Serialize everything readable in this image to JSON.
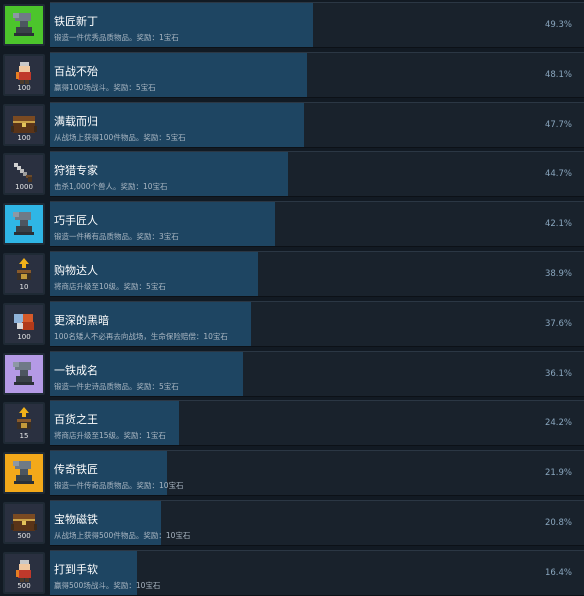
{
  "achievements": [
    {
      "title": "铁匠新丁",
      "desc": "锻造一件优秀品质物品。奖励：1宝石",
      "percent": 49.3,
      "percent_label": "49.3%",
      "icon": "anvil-icon",
      "icon_bg": "#4cc52c",
      "badge": ""
    },
    {
      "title": "百战不殆",
      "desc": "赢得100场战斗。奖励：5宝石",
      "percent": 48.1,
      "percent_label": "48.1%",
      "icon": "warrior-icon",
      "icon_bg": "#2a3040",
      "badge": "100"
    },
    {
      "title": "满载而归",
      "desc": "从战场上获得100件物品。奖励：5宝石",
      "percent": 47.7,
      "percent_label": "47.7%",
      "icon": "treasure-chest-icon",
      "icon_bg": "#2a3040",
      "badge": "100"
    },
    {
      "title": "狩猎专家",
      "desc": "击杀1,000个兽人。奖励：10宝石",
      "percent": 44.7,
      "percent_label": "44.7%",
      "icon": "sword-icon",
      "icon_bg": "#2a3040",
      "badge": "1000"
    },
    {
      "title": "巧手匠人",
      "desc": "锻造一件稀有品质物品。奖励：3宝石",
      "percent": 42.1,
      "percent_label": "42.1%",
      "icon": "anvil-icon",
      "icon_bg": "#2fb6e6",
      "badge": ""
    },
    {
      "title": "购物达人",
      "desc": "将商店升级至10级。奖励：5宝石",
      "percent": 38.9,
      "percent_label": "38.9%",
      "icon": "shop-upgrade-icon",
      "icon_bg": "#2a3040",
      "badge": "10"
    },
    {
      "title": "更深的黑暗",
      "desc": "100名矮人不必再去向战场，生命保险赔偿：10宝石",
      "percent": 37.6,
      "percent_label": "37.6%",
      "icon": "dwarf-icon",
      "icon_bg": "#2a3040",
      "badge": "100"
    },
    {
      "title": "一铁成名",
      "desc": "锻造一件史诗品质物品。奖励：5宝石",
      "percent": 36.1,
      "percent_label": "36.1%",
      "icon": "anvil-icon",
      "icon_bg": "#b49ae6",
      "badge": ""
    },
    {
      "title": "百货之王",
      "desc": "将商店升级至15级。奖励：1宝石",
      "percent": 24.2,
      "percent_label": "24.2%",
      "icon": "shop-upgrade-icon",
      "icon_bg": "#2a3040",
      "badge": "15"
    },
    {
      "title": "传奇铁匠",
      "desc": "锻造一件传奇品质物品。奖励：10宝石",
      "percent": 21.9,
      "percent_label": "21.9%",
      "icon": "anvil-icon",
      "icon_bg": "#f3a91a",
      "badge": ""
    },
    {
      "title": "宝物磁铁",
      "desc": "从战场上获得500件物品。奖励：10宝石",
      "percent": 20.8,
      "percent_label": "20.8%",
      "icon": "treasure-chest-icon",
      "icon_bg": "#2a3040",
      "badge": "500"
    },
    {
      "title": "打到手软",
      "desc": "赢得500场战斗。奖励：10宝石",
      "percent": 16.4,
      "percent_label": "16.4%",
      "icon": "warrior-icon",
      "icon_bg": "#2a3040",
      "badge": "500"
    }
  ]
}
